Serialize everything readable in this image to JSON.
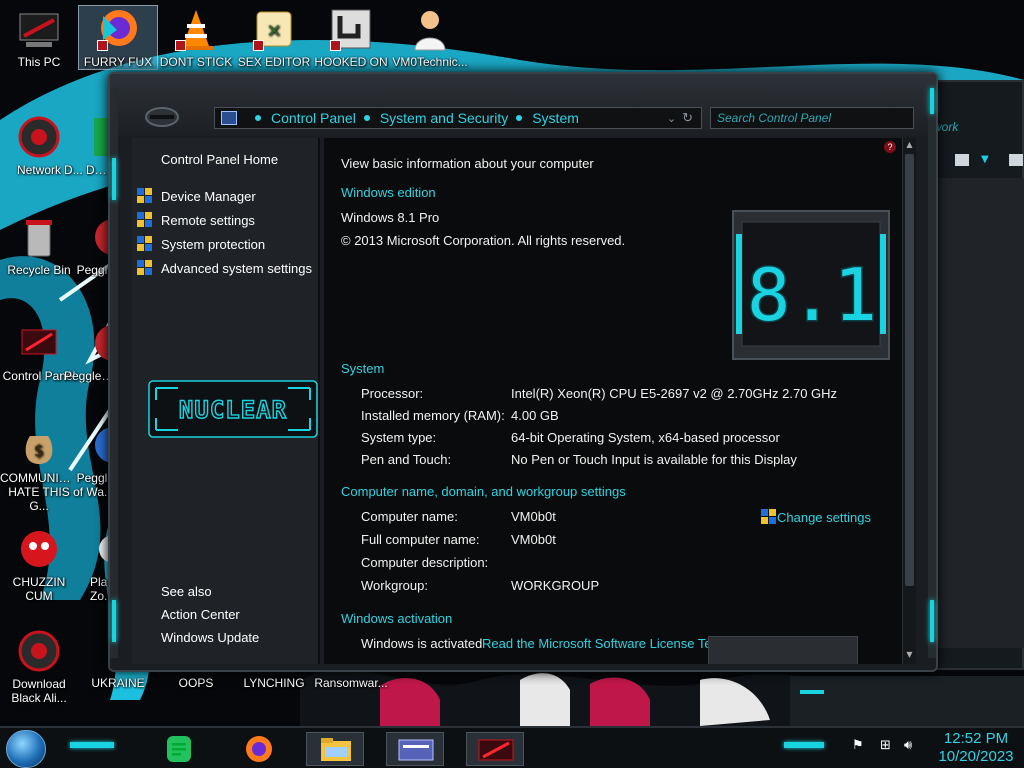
{
  "desktop": {
    "icons": [
      {
        "label": "This PC"
      },
      {
        "label": "FURRY FUX"
      },
      {
        "label": "DONT STICK"
      },
      {
        "label": "SEX EDITOR"
      },
      {
        "label": "HOOKED ON"
      },
      {
        "label": "VM0Technic..."
      },
      {
        "label": "Network"
      },
      {
        "label": "D... DUM"
      },
      {
        "label": "Recycle Bin"
      },
      {
        "label": "Peggle"
      },
      {
        "label": "Control Panel"
      },
      {
        "label": "Peggle De..."
      },
      {
        "label": "COMMUNISTS HATE THIS G..."
      },
      {
        "label": "Peggle of Wa..."
      },
      {
        "label": "CHUZZIN CUM"
      },
      {
        "label": "Plan Zo..."
      },
      {
        "label": "Download Black Ali..."
      },
      {
        "label": "UKRAINE"
      },
      {
        "label": "OOPS"
      },
      {
        "label": "LYNCHING"
      },
      {
        "label": "Ransomwar..."
      }
    ]
  },
  "window": {
    "address": {
      "crumbs": [
        "Control Panel",
        "System and Security",
        "System"
      ]
    },
    "search_placeholder": "Search Control Panel",
    "nav": {
      "home": "Control Panel Home",
      "tasks": [
        "Device Manager",
        "Remote settings",
        "System protection",
        "Advanced system settings"
      ],
      "brand": "NUCLEAR",
      "see_also": "See also",
      "see_also_links": [
        "Action Center",
        "Windows Update"
      ]
    },
    "content": {
      "heading": "View basic information about your computer",
      "edition_section": "Windows edition",
      "edition_name": "Windows 8.1 Pro",
      "copyright": "© 2013 Microsoft Corporation. All rights reserved.",
      "logo_text": "8.1",
      "system_section": "System",
      "system_rows": [
        {
          "label": "Processor:",
          "value": "Intel(R) Xeon(R) CPU E5-2697 v2 @ 2.70GHz   2.70 GHz"
        },
        {
          "label": "Installed memory (RAM):",
          "value": "4.00 GB"
        },
        {
          "label": "System type:",
          "value": "64-bit Operating System, x64-based processor"
        },
        {
          "label": "Pen and Touch:",
          "value": "No Pen or Touch Input is available for this Display"
        }
      ],
      "computer_section": "Computer name, domain, and workgroup settings",
      "computer_rows": [
        {
          "label": "Computer name:",
          "value": "VM0b0t"
        },
        {
          "label": "Full computer name:",
          "value": "VM0b0t"
        },
        {
          "label": "Computer description:",
          "value": ""
        },
        {
          "label": "Workgroup:",
          "value": "WORKGROUP"
        }
      ],
      "change_settings": "Change settings",
      "activation_section": "Windows activation",
      "activation_status": "Windows is activated",
      "license_link": "Read the Microsoft Software License Terms"
    }
  },
  "behind_window": {
    "search_fragment": "work"
  },
  "taskbar": {
    "clock_time": "12:52 PM",
    "clock_date": "10/20/2023"
  },
  "colors": {
    "accent": "#2fd3e3",
    "window_bg": "#1a1d21",
    "content_bg": "#0a0b0c"
  }
}
